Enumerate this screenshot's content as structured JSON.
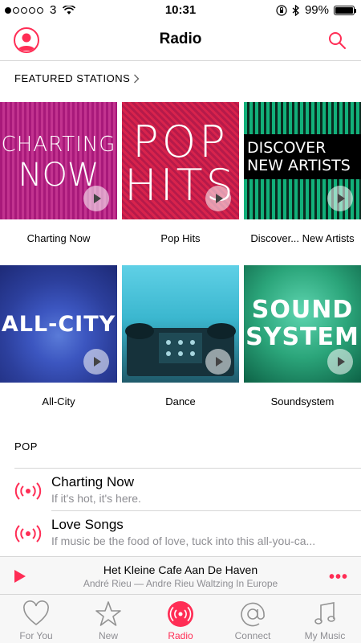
{
  "status_bar": {
    "carrier": "3",
    "time": "10:31",
    "battery": "99%",
    "battery_level": 0.99,
    "signal_bars": 1
  },
  "nav": {
    "title": "Radio",
    "avatar_icon": "person-circle-icon",
    "search_icon": "search-icon",
    "accent_color": "#ff2d55"
  },
  "featured": {
    "header": "FEATURED STATIONS",
    "stations": [
      {
        "label": "Charting Now",
        "art_line1": "CHARTING",
        "art_line2": "NOW"
      },
      {
        "label": "Pop Hits",
        "art_line1": "POP",
        "art_line2": "HITS"
      },
      {
        "label": "Discover... New Artists",
        "art_line1": "DISCOVER",
        "art_line2": "NEW ARTISTS"
      },
      {
        "label": "All-City",
        "art_line1": "ALL-CITY"
      },
      {
        "label": "Dance"
      },
      {
        "label": "Soundsystem",
        "art_line1": "SOUND",
        "art_line2": "SYSTEM"
      }
    ]
  },
  "pop": {
    "header": "POP",
    "items": [
      {
        "title": "Charting Now",
        "subtitle": "If it's hot, it's here."
      },
      {
        "title": "Love Songs",
        "subtitle": "If music be the food of love, tuck into this all-you-ca..."
      }
    ]
  },
  "mini_player": {
    "title": "Het Kleine Cafe Aan De Haven",
    "subtitle": "André Rieu — Andre Rieu Waltzing In Europe",
    "more": "•••"
  },
  "tabs": [
    {
      "label": "For You",
      "icon": "heart-icon"
    },
    {
      "label": "New",
      "icon": "star-icon"
    },
    {
      "label": "Radio",
      "icon": "radio-icon",
      "active": true
    },
    {
      "label": "Connect",
      "icon": "at-icon"
    },
    {
      "label": "My Music",
      "icon": "music-note-icon"
    }
  ]
}
